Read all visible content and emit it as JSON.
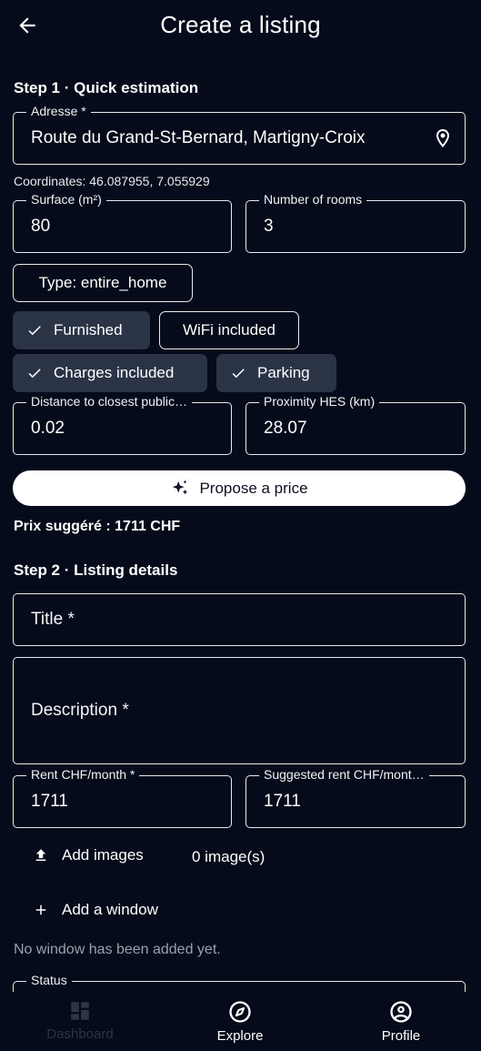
{
  "header": {
    "title": "Create a listing",
    "back_icon": "arrow-left-icon"
  },
  "step1": {
    "title": "Step 1 · Quick estimation",
    "address": {
      "label": "Adresse *",
      "value": "Route du Grand-St-Bernard, Martigny-Croix"
    },
    "coordinates": "Coordinates: 46.087955, 7.055929",
    "surface": {
      "label": "Surface (m²)",
      "value": "80"
    },
    "rooms": {
      "label": "Number of rooms",
      "value": "3"
    },
    "type_chip": "Type: entire_home",
    "chips": {
      "furnished": {
        "label": "Furnished",
        "selected": true
      },
      "wifi": {
        "label": "WiFi included",
        "selected": false
      },
      "charges": {
        "label": "Charges included",
        "selected": true
      },
      "parking": {
        "label": "Parking",
        "selected": true
      }
    },
    "distance": {
      "label": "Distance to closest public…",
      "value": "0.02"
    },
    "proximity": {
      "label": "Proximity HES (km)",
      "value": "28.07"
    },
    "propose_button": "Propose a price",
    "suggested_price": "Prix suggéré : 1711 CHF"
  },
  "step2": {
    "title": "Step 2 · Listing details",
    "title_field": {
      "placeholder": "Title *"
    },
    "description_field": {
      "placeholder": "Description *"
    },
    "rent": {
      "label": "Rent CHF/month *",
      "value": "1711"
    },
    "suggested_rent": {
      "label": "Suggested rent CHF/mont…",
      "value": "1711"
    },
    "add_images": "Add images",
    "image_count": "0 image(s)",
    "add_window": "Add a window",
    "no_window": "No window has been added yet.",
    "status": {
      "label": "Status"
    }
  },
  "nav": {
    "dashboard": "Dashboard",
    "explore": "Explore",
    "profile": "Profile"
  },
  "colors": {
    "background": "#050b1a",
    "chip_selected": "#2b3447",
    "outline": "#e8eaf0",
    "dim_nav": "#2c3446"
  }
}
